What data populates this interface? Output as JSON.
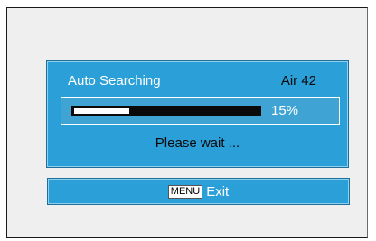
{
  "search_dialog": {
    "title": "Auto Searching",
    "channel": "Air 42",
    "progress_fraction": 0.3,
    "progress_label": "15%",
    "status": "Please wait ..."
  },
  "footer": {
    "key_label": "MENU",
    "action_label": "Exit"
  },
  "colors": {
    "panel": "#2a9fd8",
    "background": "#efefef",
    "text_light": "#ffffff",
    "text_dark": "#0a0a0a"
  }
}
